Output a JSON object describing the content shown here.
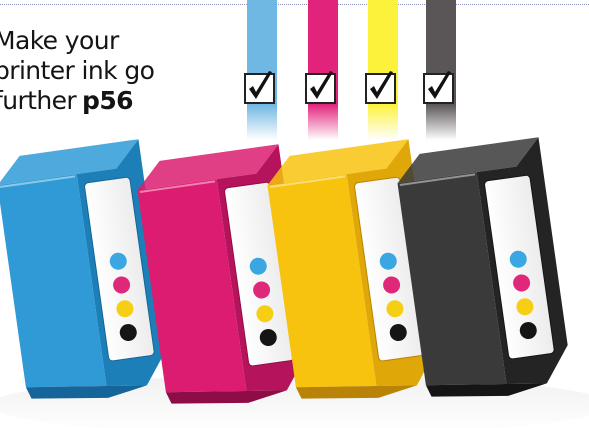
{
  "teaser": {
    "line1": "Make your",
    "line2": "printer ink go",
    "line3": "further",
    "page_ref": "p56"
  },
  "ink_colors": {
    "cyan": "#3c9fd6",
    "magenta": "#d41b6f",
    "yellow": "#f6c40f",
    "black": "#2e2e2e"
  },
  "stripes": [
    {
      "color_name": "cyan",
      "color": "#6fb8e3",
      "checked": true
    },
    {
      "color_name": "magenta",
      "color": "#e2237c",
      "checked": true
    },
    {
      "color_name": "yellow",
      "color": "#fdf23b",
      "checked": true
    },
    {
      "color_name": "black",
      "color": "#5a5556",
      "checked": true
    }
  ],
  "cartridges": [
    {
      "color_name": "cyan",
      "body": "#2f9ad6",
      "edge": "#1d7fb8",
      "dark": "#15649a"
    },
    {
      "color_name": "magenta",
      "body": "#db1c70",
      "edge": "#b5135b",
      "dark": "#8f0d46"
    },
    {
      "color_name": "yellow",
      "body": "#f7c30e",
      "edge": "#e0a708",
      "dark": "#b98307"
    },
    {
      "color_name": "black",
      "body": "#3a3a3a",
      "edge": "#242424",
      "dark": "#151515"
    }
  ],
  "dot_colors": [
    "#3aa7e3",
    "#e0287a",
    "#f6cf14",
    "#151515"
  ]
}
